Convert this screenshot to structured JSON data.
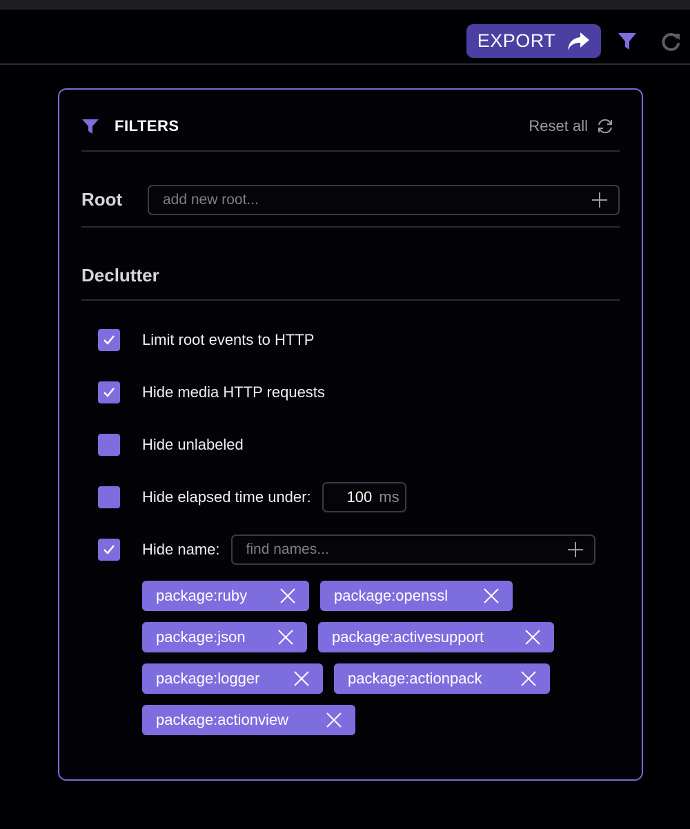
{
  "toolbar": {
    "export_label": "EXPORT",
    "icons": {
      "export": "share-arrow-icon",
      "filter": "funnel-icon",
      "reload": "reload-icon"
    }
  },
  "filters": {
    "title": "FILTERS",
    "reset_label": "Reset all",
    "root": {
      "label": "Root",
      "placeholder": "add new root..."
    },
    "declutter": {
      "label": "Declutter",
      "options": [
        {
          "label": "Limit root events to HTTP",
          "checked": true
        },
        {
          "label": "Hide media HTTP requests",
          "checked": true
        },
        {
          "label": "Hide unlabeled",
          "checked": false
        },
        {
          "label": "Hide elapsed time under:",
          "checked": false,
          "value": "100",
          "unit": "ms"
        },
        {
          "label": "Hide name:",
          "checked": true,
          "placeholder": "find names..."
        }
      ],
      "hidden_names": [
        "package:ruby",
        "package:openssl",
        "package:json",
        "package:activesupport",
        "package:logger",
        "package:actionpack",
        "package:actionview"
      ]
    }
  },
  "colors": {
    "accent": "#7e6ddf",
    "export_button": "#4c3fa3",
    "panel_border": "#7a6ad6",
    "background": "#010104"
  }
}
